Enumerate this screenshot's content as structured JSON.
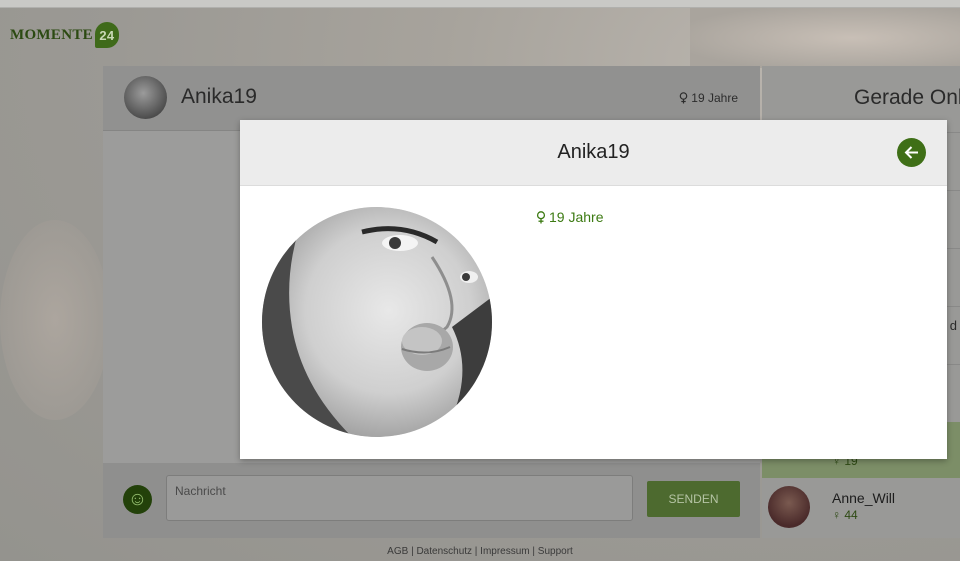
{
  "brand": {
    "name": "MOMENTE",
    "badge": "24"
  },
  "chat": {
    "partner_name": "Anika19",
    "partner_age": "19 Jahre",
    "message_placeholder": "Nachricht",
    "send_label": "SENDEN"
  },
  "online": {
    "title": "Gerade Online",
    "partial_text": "d",
    "users": [
      {
        "name": "",
        "age": "19"
      },
      {
        "name": "Anne_Will",
        "age": "44"
      }
    ]
  },
  "profile_modal": {
    "title": "Anika19",
    "age": "19 Jahre"
  },
  "footer": {
    "links": "AGB | Datenschutz | Impressum | Support"
  },
  "colors": {
    "accent": "#3f6f17",
    "age_text": "#3c7a12",
    "header_bg": "#ececec"
  }
}
